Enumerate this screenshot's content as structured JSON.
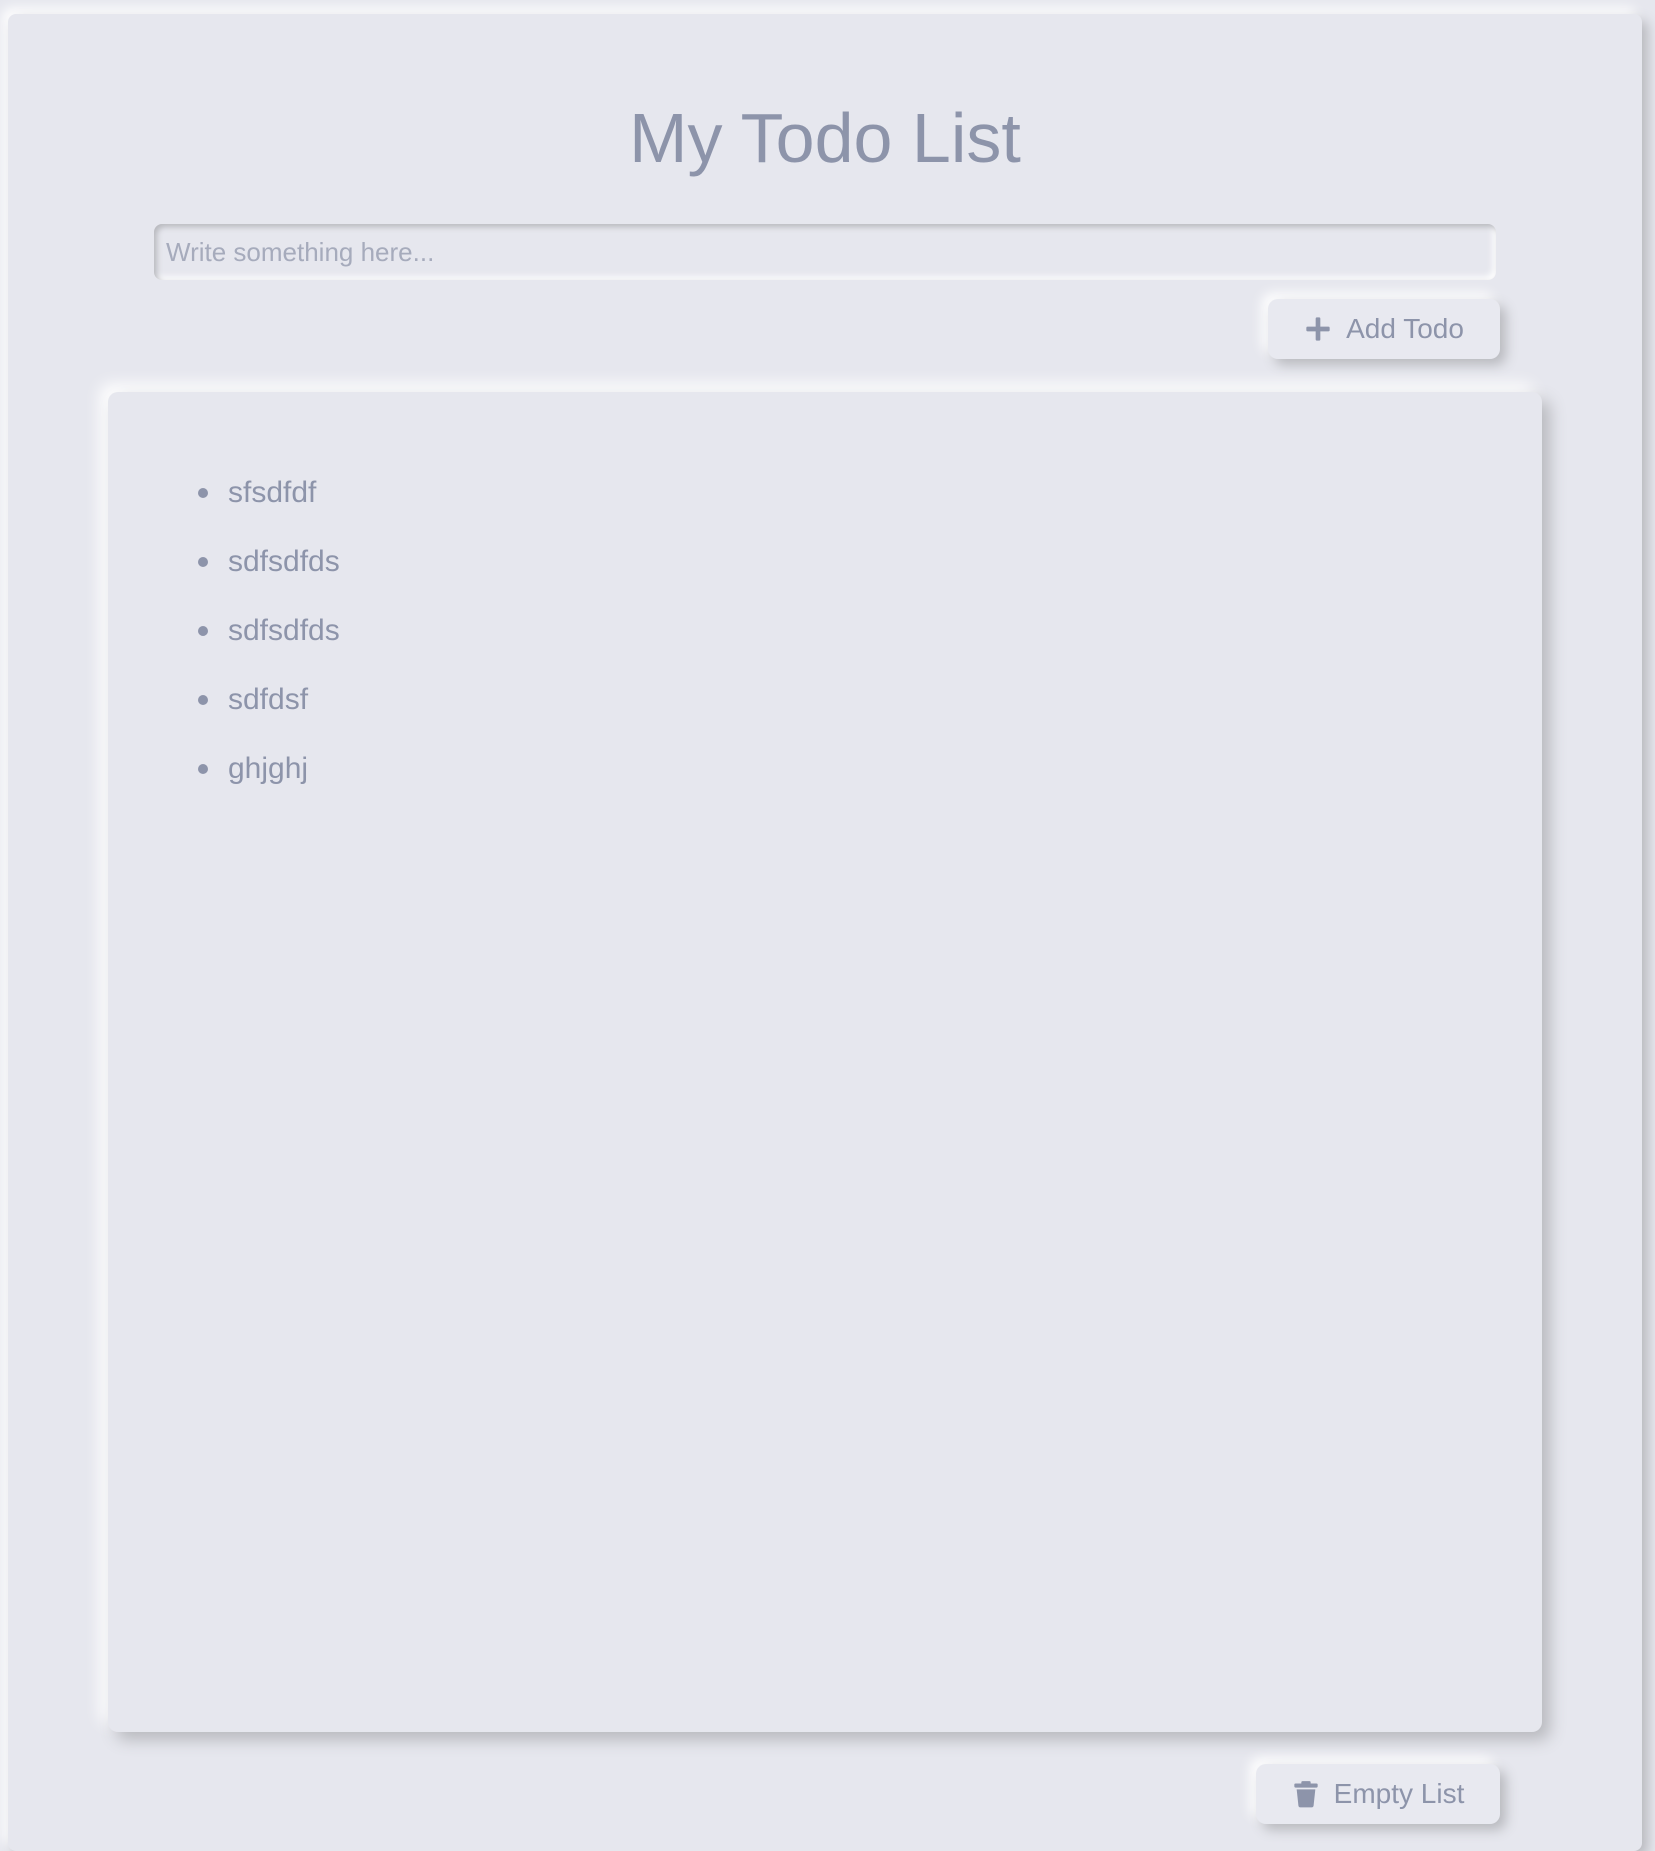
{
  "page": {
    "title": "My Todo List"
  },
  "input": {
    "placeholder": "Write something here...",
    "value": ""
  },
  "add_button": {
    "label": "Add Todo",
    "icon": "plus-icon"
  },
  "todos": [
    {
      "text": "sfsdfdf"
    },
    {
      "text": "sdfsdfds"
    },
    {
      "text": "sdfsdfds"
    },
    {
      "text": "sdfdsf"
    },
    {
      "text": "ghjghj"
    }
  ],
  "empty_button": {
    "label": "Empty List",
    "icon": "trash-icon"
  },
  "colors": {
    "background": "#e6e7ee",
    "text": "#8d94aa",
    "shadow_dark": "#b8b9be",
    "shadow_light": "#ffffff"
  }
}
